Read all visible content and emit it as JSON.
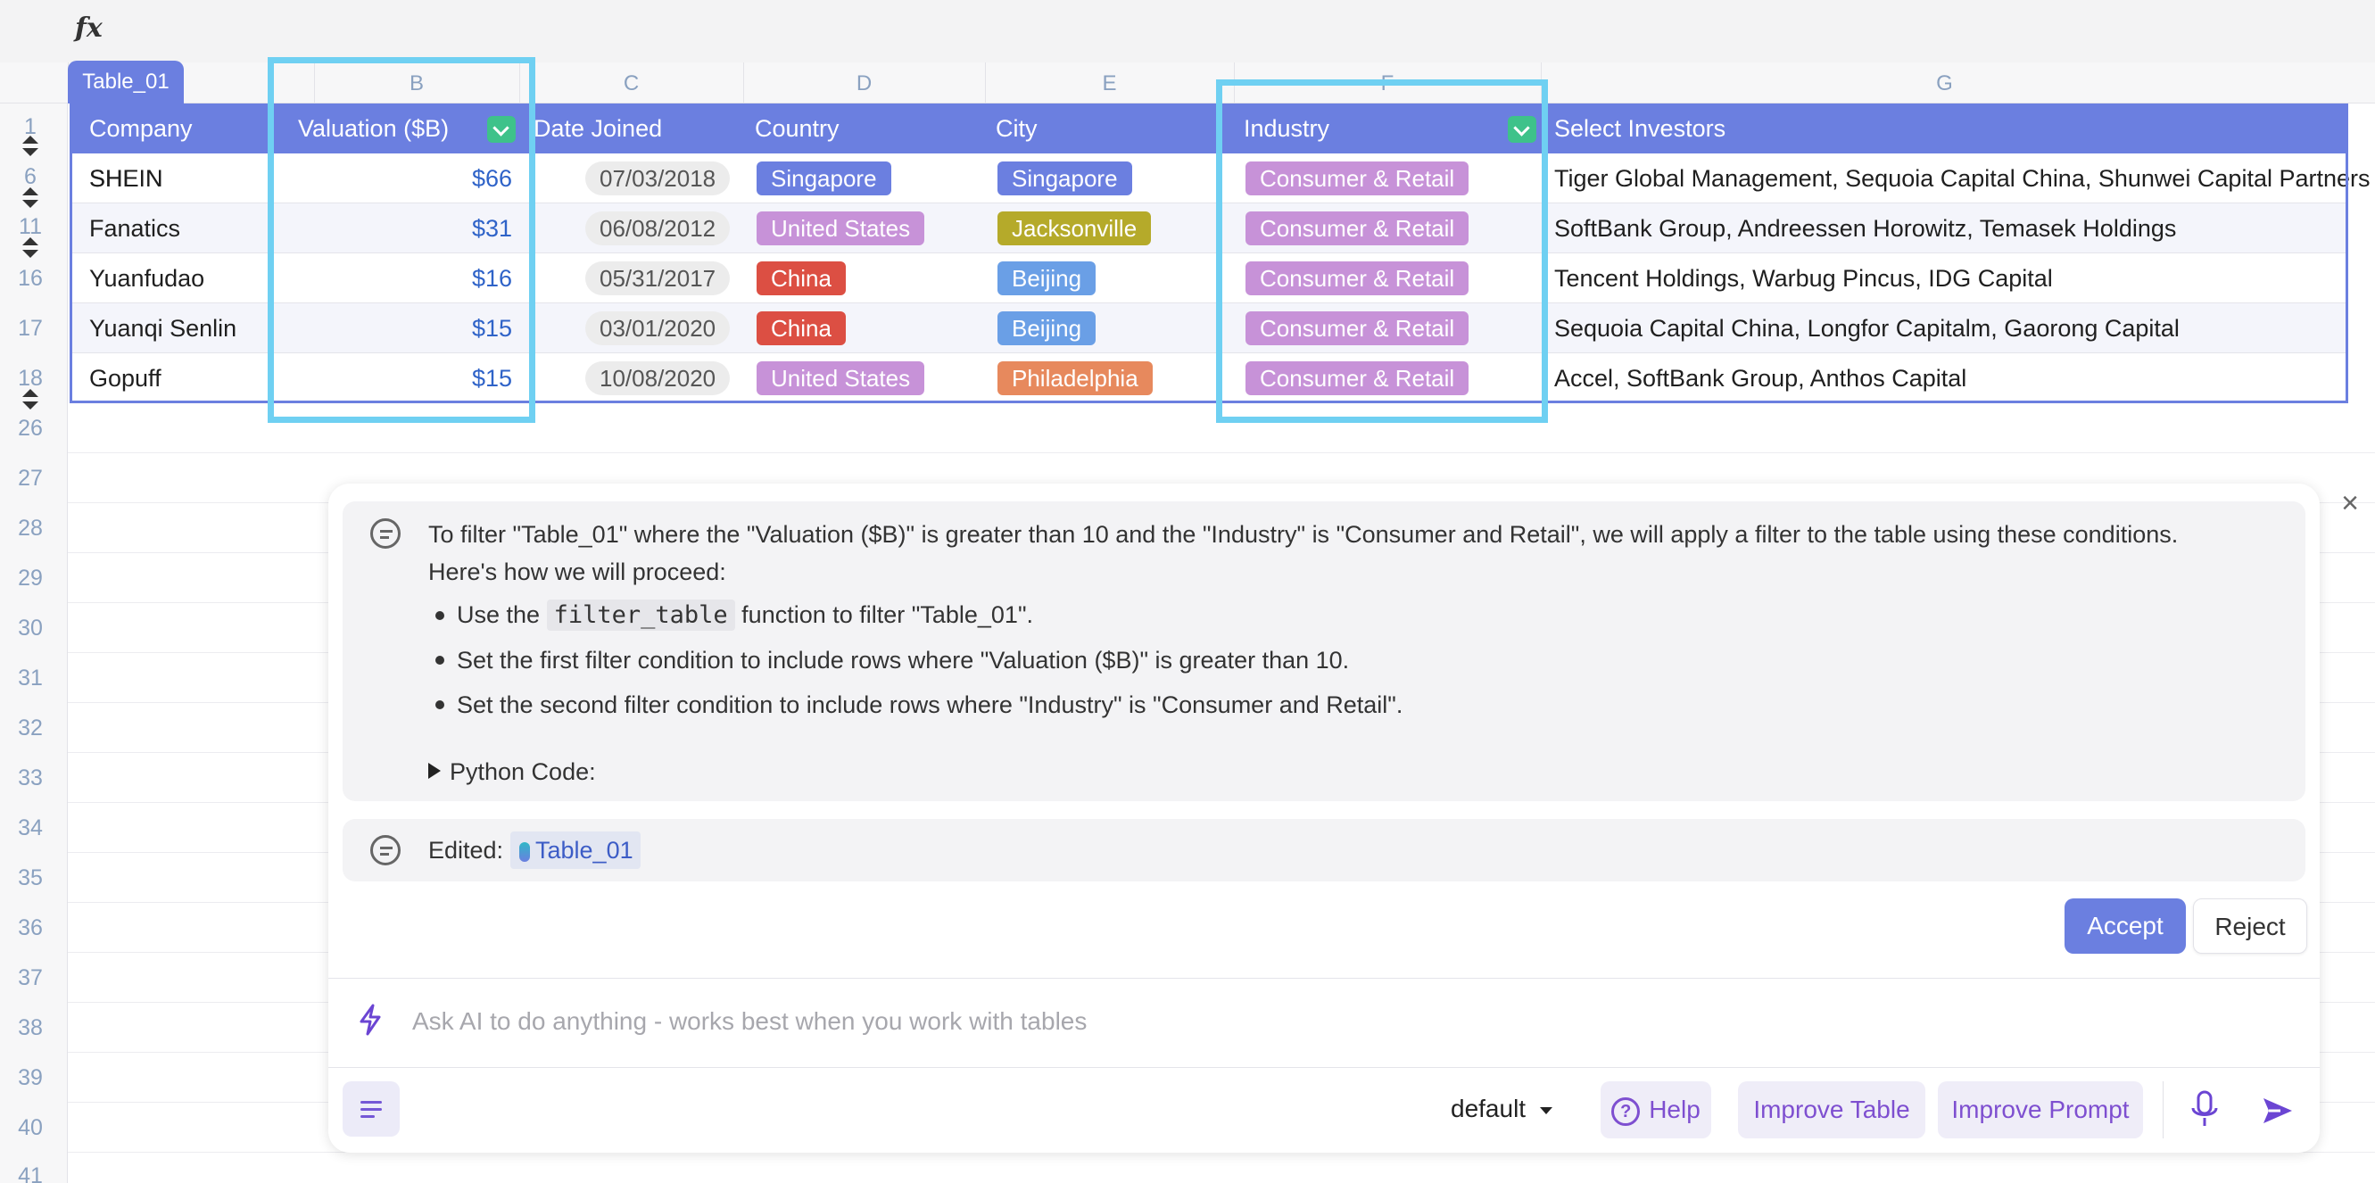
{
  "formula_bar": {
    "icon": "fx"
  },
  "columns": [
    "B",
    "C",
    "D",
    "E",
    "F",
    "G"
  ],
  "row_numbers": [
    "1",
    "6",
    "11",
    "16",
    "17",
    "18",
    "26",
    "27",
    "28",
    "29",
    "30",
    "31",
    "32",
    "33",
    "34",
    "35",
    "36",
    "37",
    "38",
    "39",
    "40",
    "41"
  ],
  "table": {
    "name": "Table_01",
    "headers": {
      "company": "Company",
      "valuation": "Valuation ($B)",
      "date_joined": "Date Joined",
      "country": "Country",
      "city": "City",
      "industry": "Industry",
      "investors": "Select Investors"
    },
    "rows": [
      {
        "company": "SHEIN",
        "valuation": "$66",
        "date_joined": "07/03/2018",
        "country": "Singapore",
        "city": "Singapore",
        "industry": "Consumer & Retail",
        "investors": "Tiger Global Management, Sequoia Capital China, Shunwei Capital Partners"
      },
      {
        "company": "Fanatics",
        "valuation": "$31",
        "date_joined": "06/08/2012",
        "country": "United States",
        "city": "Jacksonville",
        "industry": "Consumer & Retail",
        "investors": "SoftBank Group, Andreessen Horowitz, Temasek Holdings"
      },
      {
        "company": "Yuanfudao",
        "valuation": "$16",
        "date_joined": "05/31/2017",
        "country": "China",
        "city": "Beijing",
        "industry": "Consumer & Retail",
        "investors": "Tencent Holdings, Warbug Pincus, IDG Capital"
      },
      {
        "company": "Yuanqi Senlin",
        "valuation": "$15",
        "date_joined": "03/01/2020",
        "country": "China",
        "city": "Beijing",
        "industry": "Consumer & Retail",
        "investors": "Sequoia Capital China, Longfor Capitalm, Gaorong Capital"
      },
      {
        "company": "Gopuff",
        "valuation": "$15",
        "date_joined": "10/08/2020",
        "country": "United States",
        "city": "Philadelphia",
        "industry": "Consumer & Retail",
        "investors": "Accel, SoftBank Group, Anthos Capital"
      }
    ]
  },
  "colors": {
    "accent": "#6b7fe0",
    "highlight": "#6fd0f2",
    "country_singapore": "#6b7fe0",
    "country_united_states": "#c792d8",
    "country_china": "#dc4f43",
    "city_singapore": "#6b7fe0",
    "city_jacksonville": "#b5aa2a",
    "city_beijing": "#6a9fe6",
    "city_philadelphia": "#e7895d",
    "industry": "#c792d8"
  },
  "ai_panel": {
    "message": {
      "intro_line1": "To filter \"Table_01\" where the \"Valuation ($B)\" is greater than 10 and the \"Industry\" is \"Consumer and Retail\", we will apply a filter to the table using these conditions.",
      "intro_line2": "Here's how we will proceed:",
      "bullet1_pre": "Use the",
      "bullet1_code": "filter_table",
      "bullet1_post": "function to filter \"Table_01\".",
      "bullet2": "Set the first filter condition to include rows where \"Valuation ($B)\" is greater than 10.",
      "bullet3": "Set the second filter condition to include rows where \"Industry\" is \"Consumer and Retail\".",
      "code_toggle": "Python Code:"
    },
    "edited_label": "Edited:",
    "edited_table": "Table_01",
    "accept": "Accept",
    "reject": "Reject",
    "input_placeholder": "Ask AI to do anything - works best when you work with tables",
    "model": "default",
    "help": "Help",
    "improve_table": "Improve Table",
    "improve_prompt": "Improve Prompt",
    "close_symbol": "×"
  }
}
